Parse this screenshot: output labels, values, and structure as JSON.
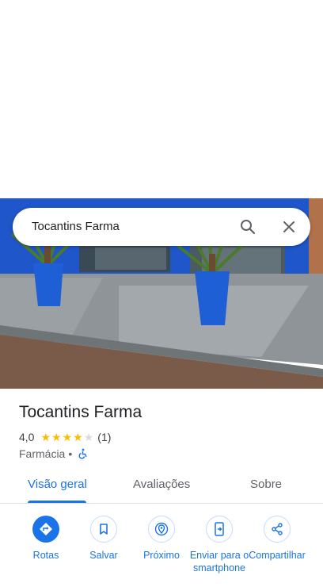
{
  "search": {
    "query": "Tocantins Farma"
  },
  "place": {
    "name": "Tocantins Farma",
    "rating": "4,0",
    "stars": [
      1,
      1,
      1,
      1,
      0
    ],
    "review_count": "(1)",
    "category": "Farmácia",
    "separator": "•"
  },
  "tabs": [
    {
      "label": "Visão geral"
    },
    {
      "label": "Avaliações"
    },
    {
      "label": "Sobre"
    }
  ],
  "actions": [
    {
      "label": "Rotas",
      "icon": "directions-icon"
    },
    {
      "label": "Salvar",
      "icon": "bookmark-icon"
    },
    {
      "label": "Próximo",
      "icon": "nearby-icon"
    },
    {
      "label": "Enviar para o smartphone",
      "icon": "send-to-phone-icon"
    },
    {
      "label": "Compartilhar",
      "icon": "share-icon"
    }
  ],
  "colors": {
    "accent": "#1a73e8",
    "star": "#fbbc04",
    "storefront": "#1f56c9"
  }
}
